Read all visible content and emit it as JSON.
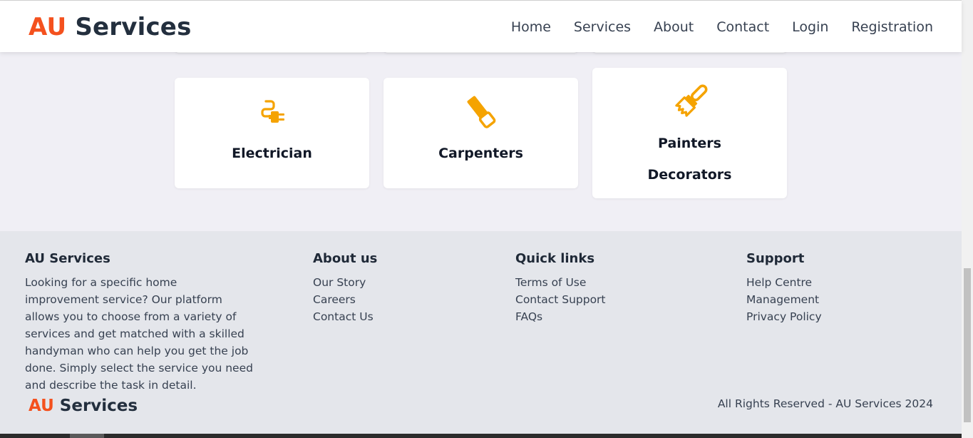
{
  "navbar": {
    "brand_prefix": "AU",
    "brand_suffix": " Services",
    "links": [
      "Home",
      "Services",
      "About",
      "Contact",
      "Login",
      "Registration"
    ]
  },
  "services": [
    {
      "label": "Electrician",
      "icon": "electric-plug-icon"
    },
    {
      "label": "Carpenters",
      "icon": "handsaw-icon"
    },
    {
      "label_line1": "Painters",
      "label_line2": "Decorators",
      "icon": "paint-brush-icon"
    }
  ],
  "footer": {
    "brand_col": {
      "heading": "AU Services",
      "text": "Looking for a specific home improvement service? Our platform allows you to choose from a variety of services and get matched with a skilled handyman who can help you get the job done. Simply select the service you need and describe the task in detail."
    },
    "about": {
      "heading": "About us",
      "links": [
        "Our Story",
        "Careers",
        "Contact Us"
      ]
    },
    "quick": {
      "heading": "Quick links",
      "links": [
        "Terms of Use",
        "Contact Support",
        "FAQs"
      ]
    },
    "support": {
      "heading": "Support",
      "links": [
        "Help Centre",
        "Management",
        "Privacy Policy"
      ]
    },
    "brand_prefix": "AU",
    "brand_suffix": " Services",
    "copyright": "All Rights Reserved - AU Services 2024"
  },
  "colors": {
    "accent": "#f4511e",
    "icon": "#f5a300",
    "dark": "#232f3e"
  }
}
